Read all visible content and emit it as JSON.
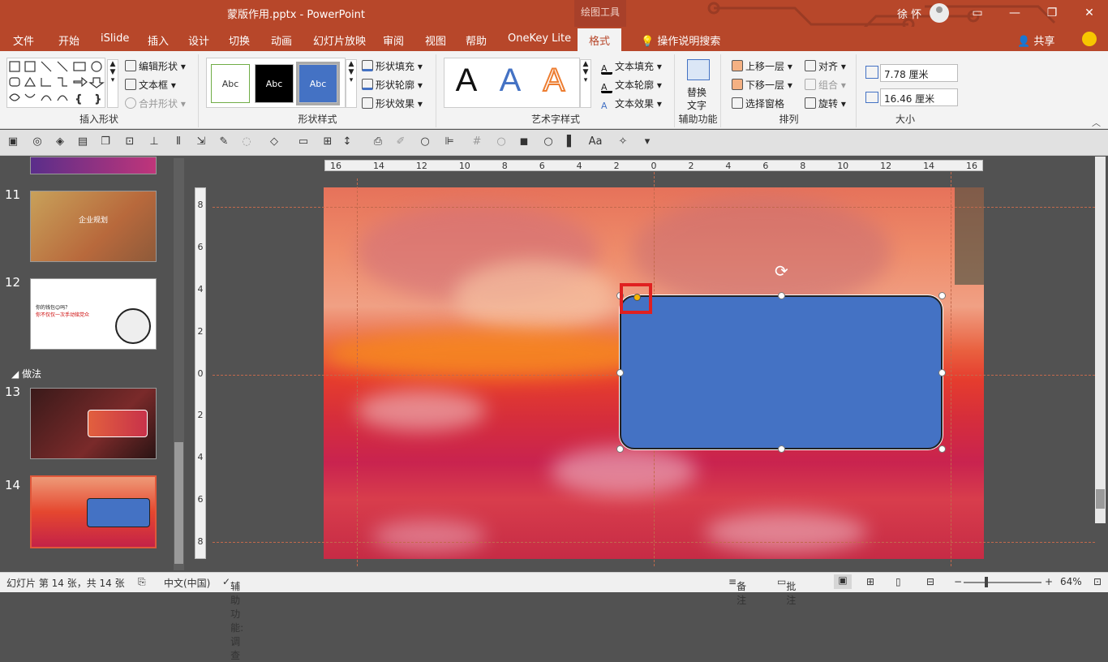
{
  "title_bar": {
    "document_title": "蒙版作用.pptx  -  PowerPoint",
    "context_tab_group": "绘图工具",
    "user_name": "徐 怀",
    "window_controls": [
      "ribbon-display-icon",
      "minimize-icon",
      "restore-icon",
      "close-icon"
    ]
  },
  "tabs": {
    "items": [
      "文件",
      "开始",
      "iSlide",
      "插入",
      "设计",
      "切换",
      "动画",
      "幻灯片放映",
      "审阅",
      "视图",
      "帮助",
      "OneKey Lite"
    ],
    "active": "格式",
    "search": "操作说明搜索",
    "share": "共享"
  },
  "ribbon": {
    "insert_shapes": {
      "label": "插入形状",
      "edit_shape": "编辑形状",
      "text_box": "文本框",
      "merge_shapes": "合并形状"
    },
    "shape_styles": {
      "label": "形状样式",
      "swatches": [
        "Abc",
        "Abc",
        "Abc"
      ],
      "fill": "形状填充",
      "outline": "形状轮廓",
      "effects": "形状效果"
    },
    "wordart_styles": {
      "label": "艺术字样式",
      "letters": [
        "A",
        "A",
        "A"
      ],
      "text_fill": "文本填充",
      "text_outline": "文本轮廓",
      "text_effects": "文本效果"
    },
    "accessibility": {
      "label": "辅助功能",
      "alt_text_1": "替换",
      "alt_text_2": "文字"
    },
    "arrange": {
      "label": "排列",
      "bring_forward": "上移一层",
      "send_backward": "下移一层",
      "selection_pane": "选择窗格",
      "align": "对齐",
      "group": "组合",
      "rotate": "旋转"
    },
    "size": {
      "label": "大小",
      "height": "7.78 厘米",
      "width": "16.46 厘米"
    }
  },
  "colors": {
    "accent": "#b7472a",
    "shape_fill": "#4472c4",
    "highlight": "#e02020"
  },
  "ruler": {
    "h_ticks": [
      "16",
      "14",
      "12",
      "10",
      "8",
      "6",
      "4",
      "2",
      "0",
      "2",
      "4",
      "6",
      "8",
      "10",
      "12",
      "14",
      "16"
    ],
    "v_ticks": [
      "8",
      "6",
      "4",
      "2",
      "0",
      "2",
      "4",
      "6",
      "8"
    ]
  },
  "thumbnails": {
    "section_label": "做法",
    "slides": [
      {
        "number": "11",
        "title": "企业规划"
      },
      {
        "number": "12",
        "lines": [
          "你的钱包😊吗？",
          "你不仅仅一次手动铭党众"
        ]
      },
      {
        "number": "13"
      },
      {
        "number": "14"
      }
    ]
  },
  "status_bar": {
    "slide_info": "幻灯片 第 14 张，共 14 张",
    "language": "中文(中国)",
    "accessibility": "辅助功能: 调查",
    "notes": "备注",
    "comments": "批注",
    "zoom": "64%"
  }
}
